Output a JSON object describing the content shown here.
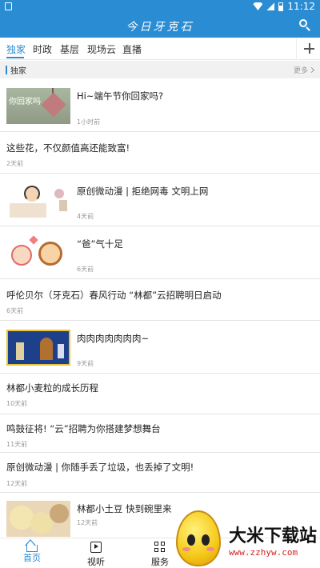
{
  "status_bar": {
    "time": "11:12"
  },
  "header": {
    "title": "今日牙克石",
    "search_icon": "search-icon"
  },
  "tabs": [
    {
      "label": "独家",
      "active": true
    },
    {
      "label": "时政",
      "active": false
    },
    {
      "label": "基层",
      "active": false
    },
    {
      "label": "现场云",
      "active": false
    },
    {
      "label": "直播",
      "active": false
    }
  ],
  "section": {
    "title": "独家",
    "more": "更多"
  },
  "feed": [
    {
      "title": "Hi~端午节你回家吗?",
      "time": "1小时前",
      "thumb_text": "你回家吗"
    },
    {
      "title": "这些花，不仅颜值高还能致富!",
      "time": "2天前"
    },
    {
      "title": "原创微动漫 | 拒绝网毒 文明上网",
      "time": "4天前"
    },
    {
      "title": "“爸”气十足",
      "time": "6天前"
    },
    {
      "title": "呼伦贝尔（牙克石）春风行动 “林都”云招聘明日启动",
      "time": "6天前"
    },
    {
      "title": "肉肉肉肉肉肉肉~",
      "time": "9天前"
    },
    {
      "title": "林都小麦粒的成长历程",
      "time": "10天前"
    },
    {
      "title": "鸣鼓征将! “云”招聘为你搭建梦想舞台",
      "time": "11天前"
    },
    {
      "title": "原创微动漫 | 你随手丢了垃圾，也丢掉了文明!",
      "time": "12天前"
    },
    {
      "title": "林都小土豆 快到碗里来",
      "time": "12天前"
    }
  ],
  "bottom_nav": [
    {
      "label": "首页",
      "icon": "home-icon",
      "active": true
    },
    {
      "label": "视听",
      "icon": "video-icon",
      "active": false
    },
    {
      "label": "服务",
      "icon": "grid-icon",
      "active": false
    }
  ],
  "watermark": {
    "title": "大米下载站",
    "url": "www.zzhyw.com"
  },
  "colors": {
    "primary": "#2a8dd4"
  }
}
